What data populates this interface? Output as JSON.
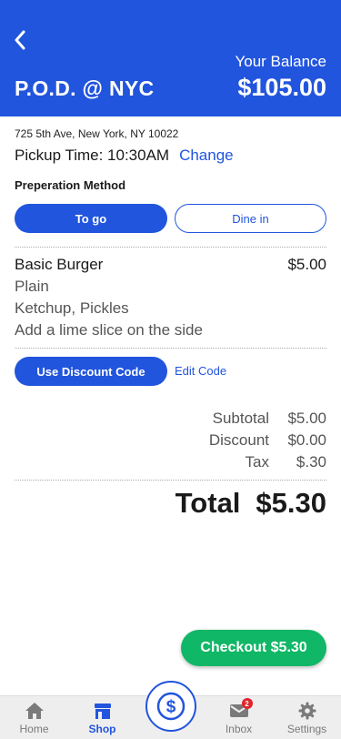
{
  "header": {
    "store_name": "P.O.D. @ NYC",
    "balance_label": "Your Balance",
    "balance_value": "$105.00"
  },
  "pickup": {
    "address": "725 5th Ave, New York, NY 10022",
    "time_label": "Pickup Time: 10:30AM",
    "change_label": "Change"
  },
  "preparation": {
    "title": "Preperation Method",
    "options": [
      {
        "label": "To go",
        "selected": true
      },
      {
        "label": "Dine in",
        "selected": false
      }
    ]
  },
  "order_item": {
    "name": "Basic Burger",
    "price": "$5.00",
    "details": [
      "Plain",
      "Ketchup, Pickles",
      "Add a lime slice on the side"
    ]
  },
  "discount": {
    "button_label": "Use Discount Code",
    "edit_label": "Edit Code"
  },
  "summary": [
    {
      "label": "Subtotal",
      "value": "$5.00"
    },
    {
      "label": "Discount",
      "value": "$0.00"
    },
    {
      "label": "Tax",
      "value": "$.30"
    }
  ],
  "total": {
    "label": "Total",
    "value": "$5.30"
  },
  "checkout": {
    "label": "Checkout $5.30"
  },
  "tabbar": {
    "items": [
      {
        "label": "Home",
        "icon": "home-icon"
      },
      {
        "label": "Shop",
        "icon": "store-icon",
        "active": true
      },
      {
        "label": "",
        "icon": "dollar-icon"
      },
      {
        "label": "Inbox",
        "icon": "mail-icon",
        "badge": "2"
      },
      {
        "label": "Settings",
        "icon": "gear-icon"
      }
    ]
  },
  "colors": {
    "primary": "#2255dd",
    "checkout": "#10b766",
    "badge": "#e0242b",
    "tabbar_bg": "#eeeeee"
  }
}
